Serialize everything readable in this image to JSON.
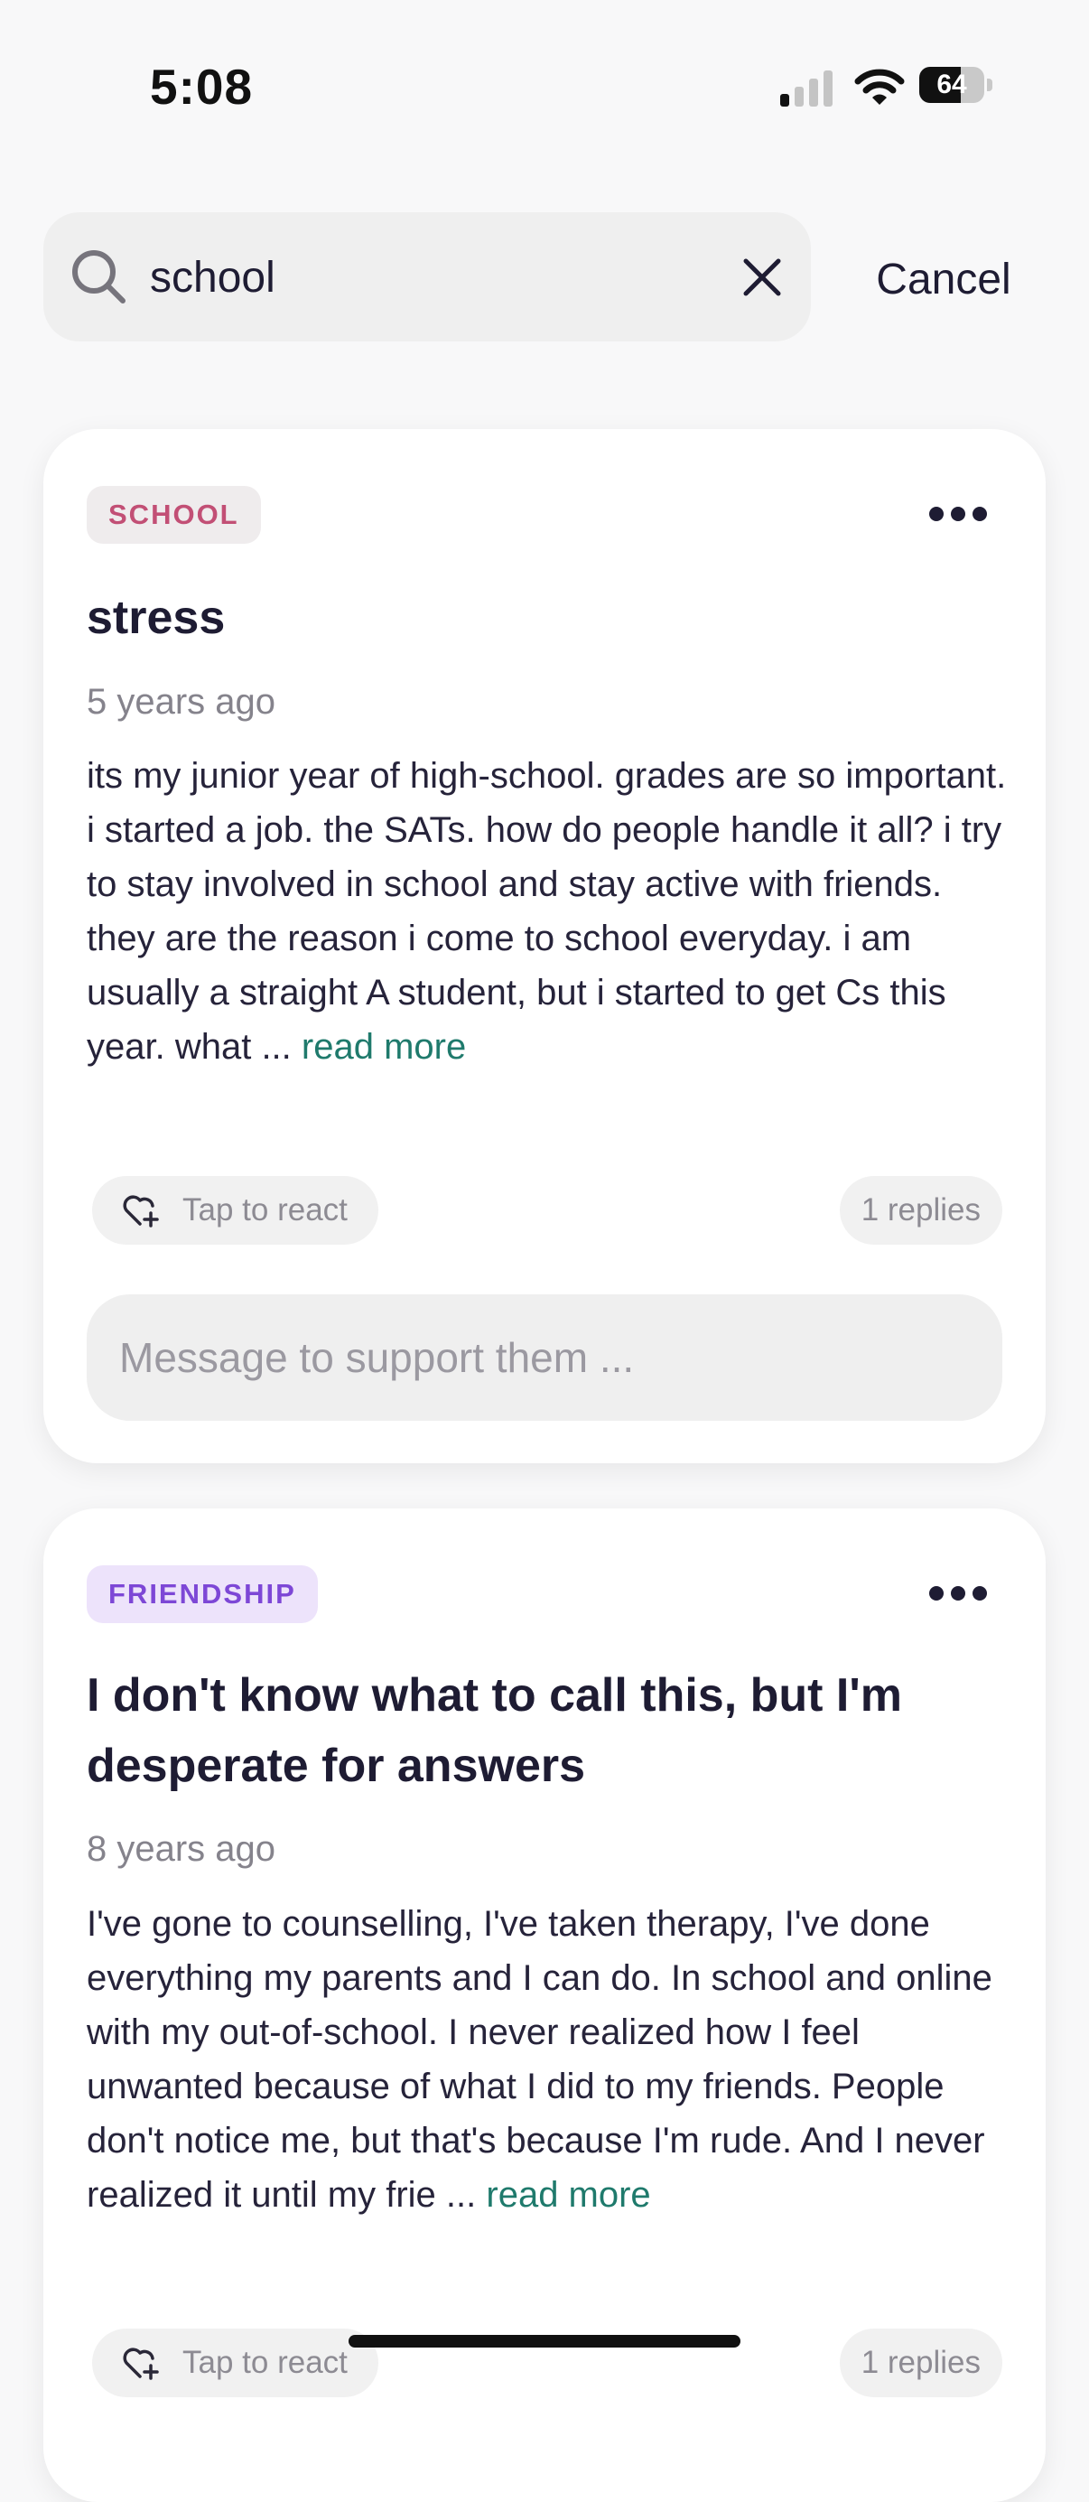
{
  "status_bar": {
    "time": "5:08",
    "battery": "64",
    "battery_level_percent": 64
  },
  "search": {
    "value": "school",
    "cancel_label": "Cancel"
  },
  "posts": [
    {
      "tag": "SCHOOL",
      "title": "stress",
      "time": "5 years ago",
      "body": "its my junior year of high-school. grades are so important. i started a job. the SATs. how do people handle it all? i try to stay involved in school and stay active with friends. they are the reason i come to school everyday. i am usually a straight A student, but i started to get Cs this year. what ...",
      "read_more": "read more",
      "react_label": "Tap to react",
      "replies": "1 replies",
      "message_placeholder": "Message to support them ..."
    },
    {
      "tag": "FRIENDSHIP",
      "title": "I don't know what to call this, but I'm desperate for answers",
      "time": "8 years ago",
      "body": "I've gone to counselling, I've taken therapy, I've done everything my parents and I can do. In school and online with my out-of-school. I never realized how I feel unwanted because of what I did to my friends. People don't notice me, but that's because I'm rude. And I never realized it until my frie ...",
      "read_more": "read more",
      "react_label": "Tap to react",
      "replies": "1 replies"
    }
  ],
  "colors": {
    "school_tag_text": "#c24f75",
    "friendship_tag_text": "#7d47d6",
    "read_more": "#1f7a6c"
  }
}
